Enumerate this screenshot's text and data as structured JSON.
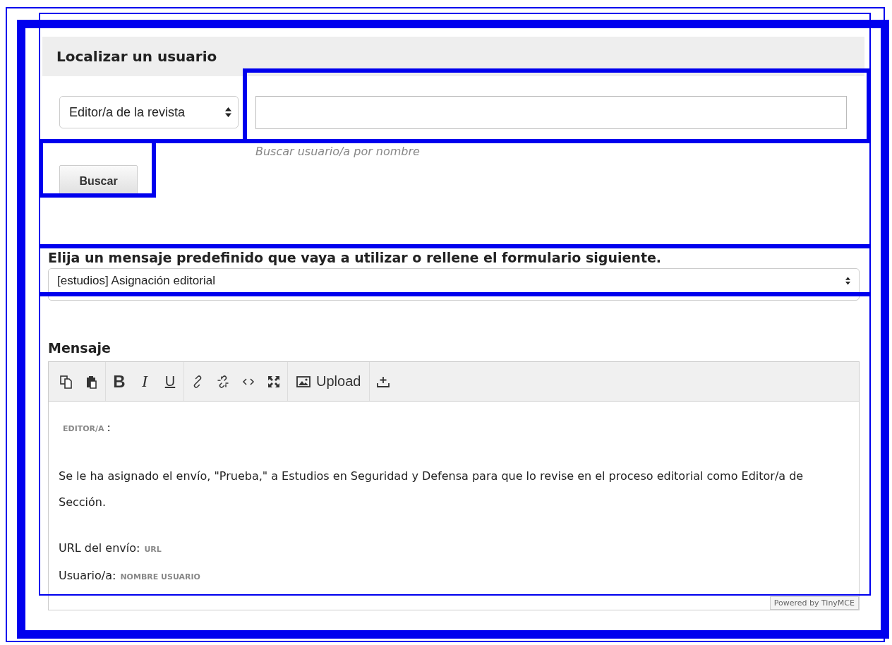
{
  "find_user": {
    "title": "Localizar un usuario",
    "role_select": {
      "value": "Editor/a de la revista"
    },
    "search_field": {
      "hint": "Buscar usuario/a por nombre"
    },
    "search_button": "Buscar"
  },
  "template": {
    "label": "Elija un mensaje predefinido que vaya a utilizar o rellene el formulario siguiente.",
    "select": {
      "value": "[estudios] Asignación editorial"
    }
  },
  "message": {
    "label": "Mensaje",
    "toolbar_groups": [
      [
        {
          "kind": "icon"
        },
        {
          "kind": "icon"
        }
      ],
      [
        {
          "kind": "text",
          "label": "B"
        },
        {
          "kind": "text",
          "label": "I"
        },
        {
          "kind": "text",
          "label": "U"
        }
      ],
      [
        {
          "kind": "icon"
        },
        {
          "kind": "icon"
        },
        {
          "kind": "icon"
        },
        {
          "kind": "icon"
        }
      ],
      [
        {
          "kind": "icon_text",
          "label": "Upload"
        }
      ],
      [
        {
          "kind": "icon"
        }
      ]
    ],
    "body": [
      {
        "kind": "variable_line",
        "variable": "EDITOR/A",
        "after": ":"
      },
      {
        "kind": "paragraph",
        "text": "Se le ha asignado el envío, \"Prueba,\" a Estudios en Seguridad y Defensa para que lo revise en el proceso editorial como Editor/a de Sección."
      },
      {
        "kind": "field_line",
        "label": "URL del envío:",
        "variable": "URL"
      },
      {
        "kind": "field_line",
        "label": "Usuario/a:",
        "variable": "NOMBRE USUARIO"
      }
    ],
    "branding": "Powered by TinyMCE"
  }
}
